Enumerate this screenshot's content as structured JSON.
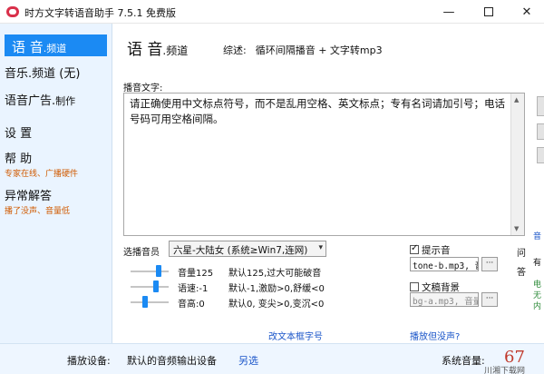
{
  "window": {
    "title": "时方文字转语音助手 7.5.1 免费版",
    "minimize_glyph": "—",
    "close_glyph": "✕",
    "icon": "app-logo-icon"
  },
  "sidebar": {
    "active": {
      "main": "语 音",
      "suffix": ".频道"
    },
    "items": [
      {
        "main": "音乐.频道 (无)"
      },
      {
        "main": "语音广告.",
        "suffix": "制作"
      },
      {
        "main": "设 置"
      },
      {
        "main": "帮 助",
        "sub": "专家在线、广播硬件"
      },
      {
        "main": "异常解答",
        "sub": "播了没声、音量低"
      }
    ]
  },
  "header": {
    "title_main": "语 音",
    "title_suffix": ".频道",
    "summary_label": "综述:",
    "summary_value": "循环间隔播音 + 文字转mp3"
  },
  "text_area": {
    "label": "播音文字:",
    "content": "请正确使用中文标点符号，而不是乱用空格、英文标点；专有名词请加引号；电话号码可用空格间隔。"
  },
  "voice": {
    "label": "选播音员",
    "selected": "六星-大陆女 (系统≥Win7,连网)",
    "caret": "▾"
  },
  "sliders": [
    {
      "label": "音量125",
      "hint": "默认125,过大可能破音",
      "value": 125
    },
    {
      "label": "语速:-1",
      "hint": "默认-1,激励>0,舒缓<0",
      "value": -1
    },
    {
      "label": "音高:0",
      "hint": "默认0, 变尖>0,变沉<0",
      "value": 0
    }
  ],
  "links": {
    "font_size": "改文本框字号",
    "no_sound": "播放但没声?"
  },
  "prompt_tone": {
    "label": "提示音",
    "checked": true,
    "file": "tone-b.mp3, 音",
    "browse": "···"
  },
  "background": {
    "label": "文稿背景",
    "checked": false,
    "file": "bg-a.mp3, 音量",
    "browse": "···"
  },
  "side_labels": {
    "wen": "问",
    "da": "答"
  },
  "right_edge": {
    "t1": "音",
    "t2": "有",
    "t3": "电",
    "t4": "无",
    "t5": "内"
  },
  "bottom": {
    "device_label": "播放设备:",
    "device_value": "默认的音频输出设备",
    "device_other": "另选",
    "volume_label": "系统音量:",
    "volume_value": "67",
    "watermark": "川湘下载网"
  },
  "colors": {
    "accent": "#1b8af3",
    "sidebar_bg": "#eaf4ff",
    "sub_orange": "#d05a00",
    "link_blue": "#1a55c9",
    "volume_red": "#c0392b"
  }
}
